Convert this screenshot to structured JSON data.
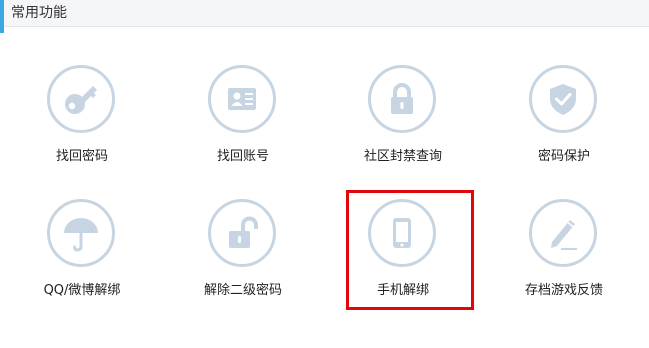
{
  "header": {
    "title": "常用功能"
  },
  "colors": {
    "accent": "#39a8e4",
    "icon": "#c7d5e2",
    "highlight": "#e0060b"
  },
  "functions": [
    {
      "label": "找回密码",
      "icon": "key-icon"
    },
    {
      "label": "找回账号",
      "icon": "id-card-icon"
    },
    {
      "label": "社区封禁查询",
      "icon": "lock-icon"
    },
    {
      "label": "密码保护",
      "icon": "shield-check-icon"
    },
    {
      "label": "QQ/微博解绑",
      "icon": "umbrella-icon"
    },
    {
      "label": "解除二级密码",
      "icon": "unlock-icon"
    },
    {
      "label": "手机解绑",
      "icon": "phone-icon"
    },
    {
      "label": "存档游戏反馈",
      "icon": "pencil-icon"
    }
  ],
  "highlighted_item": "手机解绑"
}
